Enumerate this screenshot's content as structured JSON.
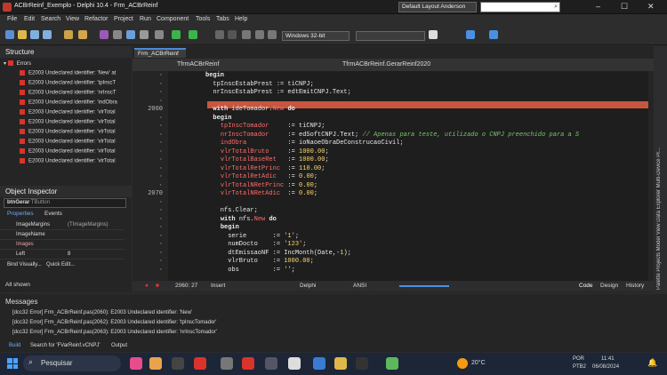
{
  "title_bar": {
    "title": "ACBrReinf_Exemplo - Delphi 10.4 - Frm_ACBrReinf",
    "layout": "Default Layout Anderson"
  },
  "menu": [
    "File",
    "Edit",
    "Search",
    "View",
    "Refactor",
    "Project",
    "Run",
    "Component",
    "Tools",
    "Tabs",
    "Help"
  ],
  "toolbar": {
    "platform": "Windows 32-bit"
  },
  "structure": {
    "title": "Structure",
    "root": "Errors",
    "items": [
      "E2003 Undeclared identifier: 'New' at",
      "E2003 Undeclared identifier: 'tpInscT",
      "E2003 Undeclared identifier: 'nrInscT",
      "E2003 Undeclared identifier: 'indObra",
      "E2003 Undeclared identifier: 'vlrTotal",
      "E2003 Undeclared identifier: 'vlrTotal",
      "E2003 Undeclared identifier: 'vlrTotal",
      "E2003 Undeclared identifier: 'vlrTotal",
      "E2003 Undeclared identifier: 'vlrTotal",
      "E2003 Undeclared identifier: 'vlrTotal"
    ]
  },
  "object_inspector": {
    "title": "Object Inspector",
    "component": "btnGerar",
    "component_type": "TButton",
    "tabs": [
      "Properties",
      "Events"
    ],
    "rows": [
      {
        "name": "ImageMargins",
        "value": "(TImageMargins)"
      },
      {
        "name": "ImageName",
        "value": ""
      },
      {
        "name": "Images",
        "value": ""
      },
      {
        "name": "Left",
        "value": "8"
      }
    ],
    "bind": "Bind Visually...",
    "quick_edit": "Quick Edit...",
    "shown": "All shown"
  },
  "editor": {
    "tab": "Frm_ACBrReinf",
    "class_combo": "TfrmACBrReinf",
    "method_combo": "TfrmACBrReinf.GerarReinf2020",
    "position": "2060: 27",
    "mode": "Insert",
    "language": "Delphi",
    "encoding": "ANSI",
    "views": [
      "Code",
      "Design",
      "History"
    ],
    "lines": [
      {
        "num": "",
        "code": "begin"
      },
      {
        "num": "",
        "code": "  tpInscEstabPrest := tiCNPJ;"
      },
      {
        "num": "",
        "code": "  nrInscEstabPrest := edtEmitCNPJ.Text;"
      },
      {
        "num": "",
        "code": ""
      },
      {
        "num": "2060",
        "code": "  with ideTomador.New do"
      },
      {
        "num": "",
        "code": "  begin"
      },
      {
        "num": "",
        "code": "    tpInscTomador     := tiCNPJ;"
      },
      {
        "num": "",
        "code": "    nrInscTomador     := edSoftCNPJ.Text; // Apenas para teste, utilizado o CNPJ preenchido para a S"
      },
      {
        "num": "",
        "code": "    indObra           := ioNaoeObraDeConstrucaoCivil;"
      },
      {
        "num": "",
        "code": "    vlrTotalBruto     := 1000.00;"
      },
      {
        "num": "",
        "code": "    vlrTotalBaseRet   := 1000.00;"
      },
      {
        "num": "",
        "code": "    vlrTotalRetPrinc  := 110.00;"
      },
      {
        "num": "",
        "code": "    vlrTotalRetAdic   := 0.00;"
      },
      {
        "num": "",
        "code": "    vlrTotalNRetPrinc := 0.00;"
      },
      {
        "num": "2070",
        "code": "    vlrTotalNRetAdic  := 0.00;"
      },
      {
        "num": "",
        "code": ""
      },
      {
        "num": "",
        "code": "    nfs.Clear;"
      },
      {
        "num": "",
        "code": "    with nfs.New do"
      },
      {
        "num": "",
        "code": "    begin"
      },
      {
        "num": "",
        "code": "      serie       := '1';"
      },
      {
        "num": "",
        "code": "      numDocto    := '123';"
      },
      {
        "num": "",
        "code": "      dtEmissaoNF := IncMonth(Date,-1);"
      },
      {
        "num": "",
        "code": "      vlrBruto    := 1000.00;"
      },
      {
        "num": "",
        "code": "      obs         := '';"
      }
    ]
  },
  "right_strip": "Palette   Projects  Model View  Data Explorer  Multi-Device Pr...",
  "messages": {
    "title": "Messages",
    "items": [
      "[dcc32 Error] Frm_ACBrReinf.pas(2060): E2003 Undeclared identifier: 'New'",
      "[dcc32 Error] Frm_ACBrReinf.pas(2062): E2003 Undeclared identifier: 'tpInscTomador'",
      "[dcc32 Error] Frm_ACBrReinf.pas(2063): E2003 Undeclared identifier: 'nrInscTomador'"
    ],
    "tabs": [
      "Build",
      "Search for 'FVarReinf.vCNPJ'",
      "Output"
    ]
  },
  "taskbar": {
    "search": "Pesquisar",
    "temp": "20°C",
    "lang": "POR",
    "kbd": "PTB2",
    "time": "11:41",
    "date": "06/08/2024"
  }
}
